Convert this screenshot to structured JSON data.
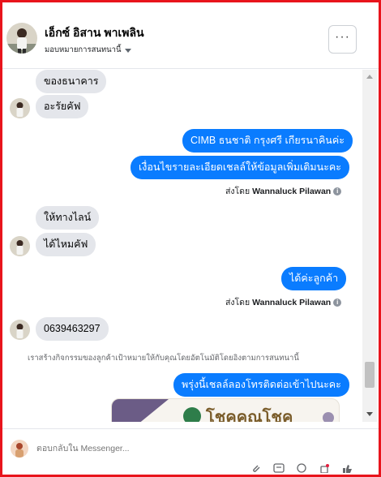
{
  "header": {
    "contact_name": "เอ็กซ์ อิสาน พาเพลิน",
    "assign_label": "มอบหมายการสนทนานี้",
    "more_button": "···"
  },
  "messages": {
    "m1": "ของธนาคาร",
    "m2": "อะรัยคัฟ",
    "m3": "CIMB ธนชาติ กรุงศรี เกียรนาคินค่ะ",
    "m4": "เงื่อนไขรายละเอียดเชลล์ให้ข้อมูลเพิ่มเติมนะคะ",
    "m5": "ให้ทางไลน์",
    "m6": "ได้ไหมคัฟ",
    "m7": "ได้ค่ะลูกค้า",
    "m8": "0639463297",
    "m9": "พรุ่งนี้เชลล์ลองโทรติดต่อเข้าไปนะคะ"
  },
  "senders": {
    "prefix": "ส่งโดย",
    "name": "Wannaluck Pilawan",
    "info_icon": "i"
  },
  "notice": "เราสร้างกิจกรรมของลูกค้าเป้าหมายให้กับคุณโดยอัตโนมัติโดยอิงตามการสนทนานี้",
  "ad_card": {
    "brand_text": "โชคคูณโชค"
  },
  "composer": {
    "placeholder": "ตอบกลับใน Messenger..."
  },
  "colors": {
    "outgoing": "#0a7cff",
    "incoming": "#e4e6eb",
    "frame": "#e8141c"
  }
}
